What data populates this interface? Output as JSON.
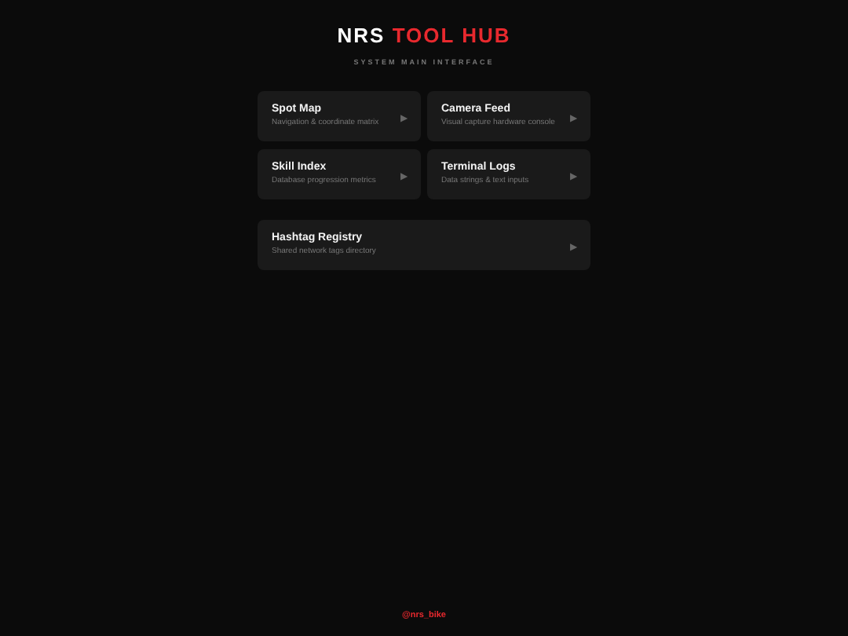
{
  "header": {
    "title_part_1": "NRS",
    "title_part_2": "TOOL HUB",
    "subtitle": "SYSTEM MAIN INTERFACE"
  },
  "tools": [
    {
      "title": "Spot Map",
      "description": "Navigation & coordinate matrix",
      "arrow": "▶",
      "kind": "half"
    },
    {
      "title": "Camera Feed",
      "description": "Visual capture hardware console",
      "arrow": "▶",
      "kind": "half"
    },
    {
      "title": "Skill Index",
      "description": "Database progression metrics",
      "arrow": "▶",
      "kind": "half"
    },
    {
      "title": "Terminal Logs",
      "description": "Data strings & text inputs",
      "arrow": "▶",
      "kind": "half"
    },
    {
      "title": "Hashtag Registry",
      "description": "Shared network tags directory",
      "arrow": "▶",
      "kind": "wide"
    }
  ],
  "footer": {
    "handle": "@nrs_bike"
  }
}
